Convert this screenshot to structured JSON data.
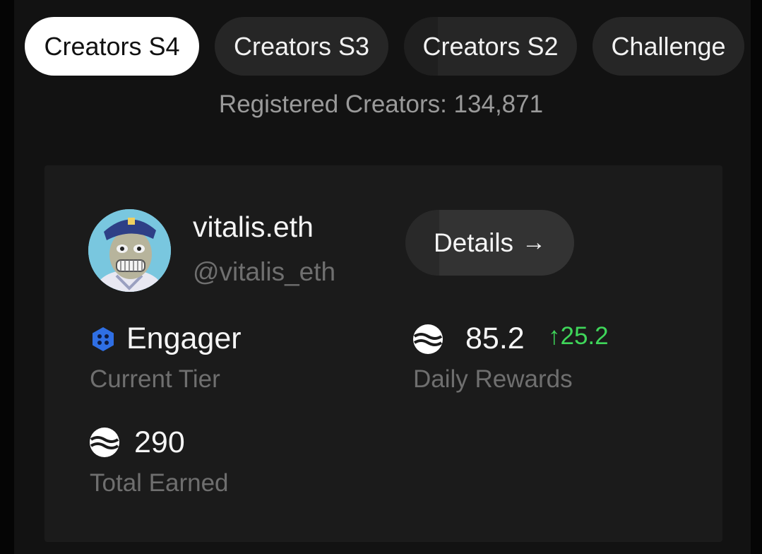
{
  "tabs": [
    {
      "label": "Creators S4",
      "active": true
    },
    {
      "label": "Creators S3",
      "active": false
    },
    {
      "label": "Creators S2",
      "active": false
    },
    {
      "label": "Challenge",
      "active": false
    }
  ],
  "registered_text": "Registered Creators: 134,871",
  "profile": {
    "display_name": "vitalis.eth",
    "handle": "@vitalis_eth",
    "details_label": "Details",
    "details_arrow": "→"
  },
  "stats": {
    "tier": {
      "value": "Engager",
      "label": "Current Tier",
      "icon": "hexagon-tier-icon"
    },
    "daily": {
      "value": "85.2",
      "change": "↑25.2",
      "label": "Daily Rewards",
      "icon": "token-icon"
    },
    "total": {
      "value": "290",
      "label": "Total Earned",
      "icon": "token-icon"
    }
  },
  "colors": {
    "accent_green": "#3fd65a",
    "tier_blue": "#2f6fe4"
  }
}
